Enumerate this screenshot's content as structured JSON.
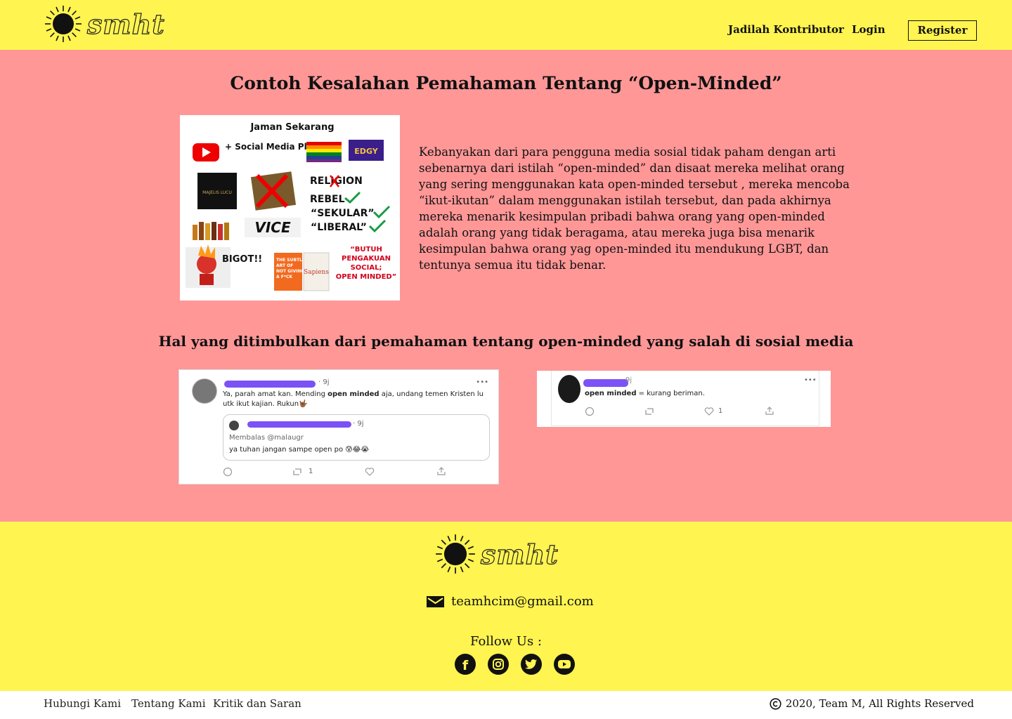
{
  "header": {
    "logo_text": "smht",
    "nav": {
      "contributor": "Jadilah Kontributor",
      "login": "Login",
      "register": "Register"
    }
  },
  "main": {
    "title": "Contoh Kesalahan Pemahaman Tentang “Open-Minded”",
    "image1": {
      "heading": "Jaman Sekarang",
      "social_media": "+ Social Media Platform",
      "flag_word": "EDGY",
      "majelis": "MAJELIS LUCU",
      "religion": "RELIGION",
      "rebel": "REBEL",
      "sekular": "“SEKULAR”",
      "liberal": "“LIBERAL”",
      "vice": "VICE",
      "bigot": "BIGOT!!",
      "book1": "THE SUBTLE ART OF NOT GIVING A F*CK",
      "book2": "Sapiens",
      "butuh": "“BUTUH PENGAKUAN SOSIAL; OPEN MINDED”"
    },
    "paragraph": "Kebanyakan dari para pengguna media sosial tidak paham dengan arti sebenarnya dari istilah “open-minded” dan disaat mereka melihat orang yang sering menggunakan kata open-minded tersebut , mereka mencoba “ikut-ikutan” dalam menggunakan istilah tersebut, dan pada akhirnya mereka menarik kesimpulan pribadi bahwa orang yang open-minded adalah orang yang tidak beragama, atau mereka juga bisa menarik kesimpulan bahwa orang yag open-minded itu mendukung LGBT, dan tentunya semua itu tidak benar.",
    "subtitle": "Hal yang ditimbulkan dari pemahaman tentang open-minded yang salah di sosial media",
    "tweet1": {
      "time": "· 9j",
      "text_before": "Ya, parah amat kan. Mending ",
      "text_bold": "open minded",
      "text_after": " aja, undang temen Kristen lu utk ikut kajian. Rukun🤟🏾",
      "quote_time": "· 9j",
      "quote_reply": "Membalas @malaugr",
      "quote_text": "ya tuhan jangan sampe open po 😰😂😭",
      "retweets": "1",
      "more": "•••"
    },
    "tweet2": {
      "time": "9j",
      "text_bold": "open minded",
      "text_after": " = kurang beriman.",
      "likes": "1",
      "more": "•••"
    }
  },
  "footer": {
    "logo_text": "smht",
    "email": "teamhcim@gmail.com",
    "follow": "Follow Us :",
    "links": [
      "Hubungi Kami",
      "Tentang Kami",
      "Kritik dan Saran"
    ],
    "copyright": "2020, Team M, All Rights Reserved"
  }
}
